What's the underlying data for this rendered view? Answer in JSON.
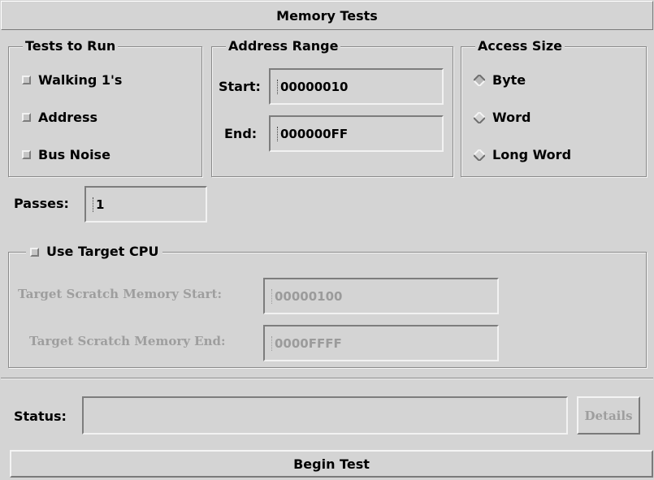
{
  "window": {
    "title": "Memory Tests"
  },
  "tests_group": {
    "legend": "Tests to Run",
    "items": [
      {
        "label": "Walking 1's",
        "checked": false
      },
      {
        "label": "Address",
        "checked": false
      },
      {
        "label": "Bus Noise",
        "checked": false
      }
    ]
  },
  "address_group": {
    "legend": "Address Range",
    "start_label": "Start:",
    "start_value": "00000010",
    "end_label": "End:",
    "end_value": "000000FF"
  },
  "access_group": {
    "legend": "Access Size",
    "options": [
      {
        "label": "Byte",
        "selected": true
      },
      {
        "label": "Word",
        "selected": false
      },
      {
        "label": "Long Word",
        "selected": false
      }
    ]
  },
  "passes": {
    "label": "Passes:",
    "value": "1"
  },
  "target_cpu": {
    "label": "Use Target CPU",
    "checked": false,
    "scratch_start_label": "Target Scratch Memory Start:",
    "scratch_start_value": "00000100",
    "scratch_end_label": "Target Scratch Memory End:",
    "scratch_end_value": "0000FFFF"
  },
  "status": {
    "label": "Status:",
    "value": "",
    "details_label": "Details"
  },
  "begin_button": {
    "label": "Begin Test"
  }
}
